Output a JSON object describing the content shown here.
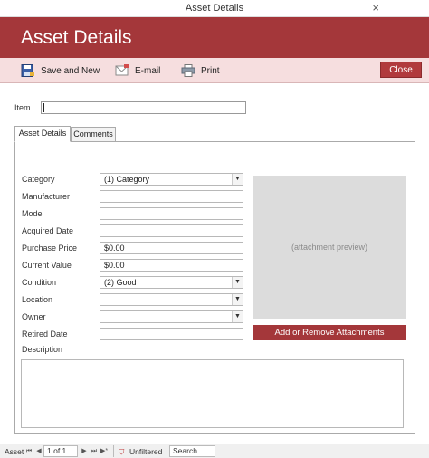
{
  "window": {
    "title": "Asset Details",
    "close_glyph": "×"
  },
  "header": {
    "title": "Asset Details"
  },
  "toolbar": {
    "save_new": "Save and New",
    "email": "E-mail",
    "print": "Print",
    "close": "Close"
  },
  "item": {
    "label": "Item",
    "value": ""
  },
  "tabs": [
    {
      "label": "Asset Details"
    },
    {
      "label": "Comments"
    }
  ],
  "fields": {
    "category": {
      "label": "Category",
      "value": "(1) Category"
    },
    "manufacturer": {
      "label": "Manufacturer",
      "value": ""
    },
    "model": {
      "label": "Model",
      "value": ""
    },
    "acquired_date": {
      "label": "Acquired Date",
      "value": ""
    },
    "purchase_price": {
      "label": "Purchase Price",
      "value": "$0.00"
    },
    "current_value": {
      "label": "Current Value",
      "value": "$0.00"
    },
    "condition": {
      "label": "Condition",
      "value": "(2) Good"
    },
    "location": {
      "label": "Location",
      "value": ""
    },
    "owner": {
      "label": "Owner",
      "value": ""
    },
    "retired_date": {
      "label": "Retired Date",
      "value": ""
    },
    "description": {
      "label": "Description",
      "value": ""
    }
  },
  "attachment": {
    "preview_text": "(attachment preview)",
    "button": "Add or Remove Attachments"
  },
  "navbar": {
    "record_label": "Asset",
    "position": "1 of 1",
    "filter": "Unfiltered",
    "search": "Search"
  },
  "colors": {
    "accent": "#a4373a",
    "toolbar_bg": "#f6dedf",
    "preview_bg": "#dcdcdc"
  },
  "icons": [
    "save-icon",
    "email-icon",
    "print-icon",
    "filter-icon"
  ]
}
